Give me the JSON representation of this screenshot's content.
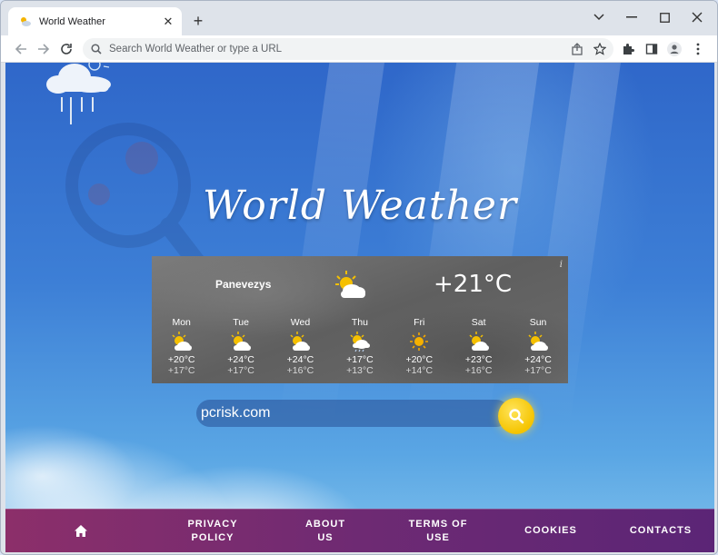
{
  "browser": {
    "tab_title": "World Weather",
    "omnibox_placeholder": "Search World Weather or type a URL"
  },
  "page": {
    "site_title": "World Weather",
    "weather": {
      "info_label": "i",
      "city": "Panevezys",
      "current_temp": "+21°C",
      "current_icon": "partly-cloudy-icon",
      "forecast": [
        {
          "day": "Mon",
          "icon": "partly-cloudy-icon",
          "high": "+20°C",
          "low": "+17°C"
        },
        {
          "day": "Tue",
          "icon": "partly-cloudy-icon",
          "high": "+24°C",
          "low": "+17°C"
        },
        {
          "day": "Wed",
          "icon": "partly-cloudy-icon",
          "high": "+24°C",
          "low": "+16°C"
        },
        {
          "day": "Thu",
          "icon": "partly-cloudy-rain-icon",
          "high": "+17°C",
          "low": "+13°C"
        },
        {
          "day": "Fri",
          "icon": "sunny-icon",
          "high": "+20°C",
          "low": "+14°C"
        },
        {
          "day": "Sat",
          "icon": "partly-cloudy-icon",
          "high": "+23°C",
          "low": "+16°C"
        },
        {
          "day": "Sun",
          "icon": "partly-cloudy-icon",
          "high": "+24°C",
          "low": "+17°C"
        }
      ]
    },
    "search": {
      "value": "pcrisk.com"
    },
    "footer": {
      "home_icon": "home-icon",
      "links": [
        "PRIVACY POLICY",
        "ABOUT US",
        "TERMS OF USE",
        "COOKIES",
        "CONTACTS"
      ]
    }
  },
  "colors": {
    "footer_start": "#8c2f6a",
    "footer_end": "#5b2576",
    "search_button": "#f5c400",
    "sky": "#3d7fd6"
  }
}
